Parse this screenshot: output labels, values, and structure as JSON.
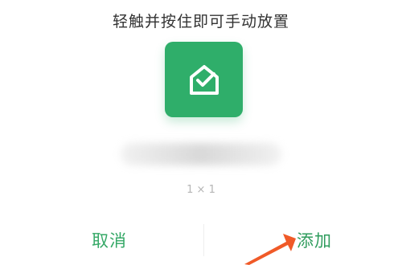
{
  "dialog": {
    "hint_text": "轻触并按住即可手动放置",
    "widget": {
      "icon": "house-check-icon",
      "size_text": "1 × 1",
      "accent_color": "#2fae6a"
    },
    "buttons": {
      "cancel_label": "取消",
      "add_label": "添加"
    },
    "annotation": {
      "arrow_color": "#f05a28"
    }
  }
}
